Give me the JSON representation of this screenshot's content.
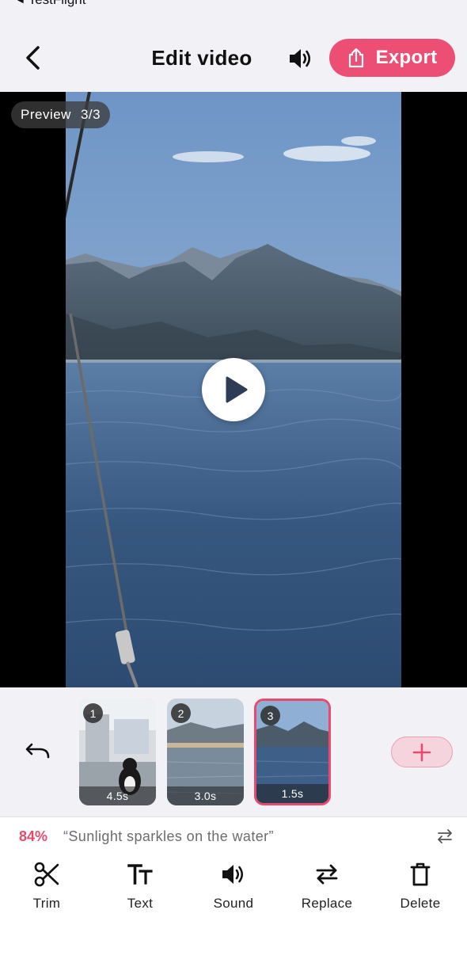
{
  "status": {
    "back_app_label": "TestFlight"
  },
  "header": {
    "title": "Edit video",
    "export_label": "Export"
  },
  "preview": {
    "badge_label": "Preview",
    "badge_count": "3/3"
  },
  "timeline": {
    "clips": [
      {
        "number": "1",
        "duration": "4.5s",
        "selected": false
      },
      {
        "number": "2",
        "duration": "3.0s",
        "selected": false
      },
      {
        "number": "3",
        "duration": "1.5s",
        "selected": true
      }
    ]
  },
  "caption": {
    "score": "84%",
    "text": "“Sunlight sparkles on the water”"
  },
  "toolbar": {
    "tools": [
      {
        "label": "Trim",
        "icon": "scissors-icon"
      },
      {
        "label": "Text",
        "icon": "text-icon"
      },
      {
        "label": "Sound",
        "icon": "speaker-icon"
      },
      {
        "label": "Replace",
        "icon": "replace-icon"
      },
      {
        "label": "Delete",
        "icon": "trash-icon"
      }
    ]
  },
  "colors": {
    "accent": "#ec4f73",
    "background": "#f2f1f6",
    "add_button_fill": "#f6d4dd"
  }
}
